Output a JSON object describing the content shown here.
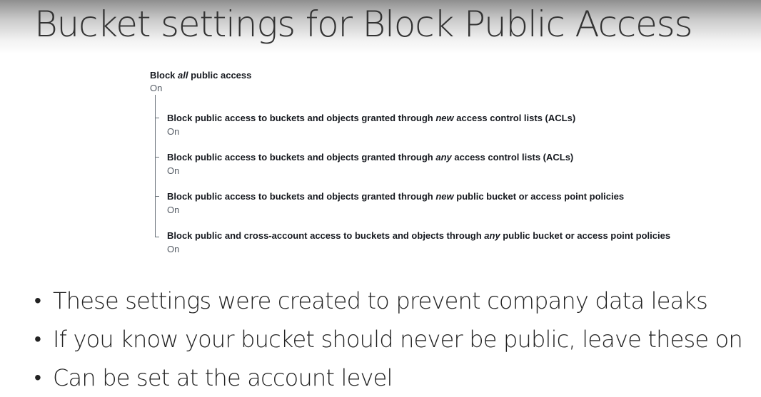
{
  "slide": {
    "title": "Bucket settings for Block Public Access"
  },
  "block_public_access": {
    "main": {
      "label_before": "Block ",
      "label_em": "all",
      "label_after": " public access",
      "value": "On"
    },
    "settings": [
      {
        "label_before": "Block public access to buckets and objects granted through ",
        "label_em": "new",
        "label_after": " access control lists (ACLs)",
        "value": "On"
      },
      {
        "label_before": "Block public access to buckets and objects granted through ",
        "label_em": "any",
        "label_after": " access control lists (ACLs)",
        "value": "On"
      },
      {
        "label_before": "Block public access to buckets and objects granted through ",
        "label_em": "new",
        "label_after": " public bucket or access point policies",
        "value": "On"
      },
      {
        "label_before": "Block public and cross-account access to buckets and objects through ",
        "label_em": "any",
        "label_after": " public bucket or access point policies",
        "value": "On"
      }
    ]
  },
  "bullets": [
    "These settings were created to prevent company data leaks",
    "If you know your bucket should never be public, leave these on",
    "Can be set at the account level"
  ]
}
